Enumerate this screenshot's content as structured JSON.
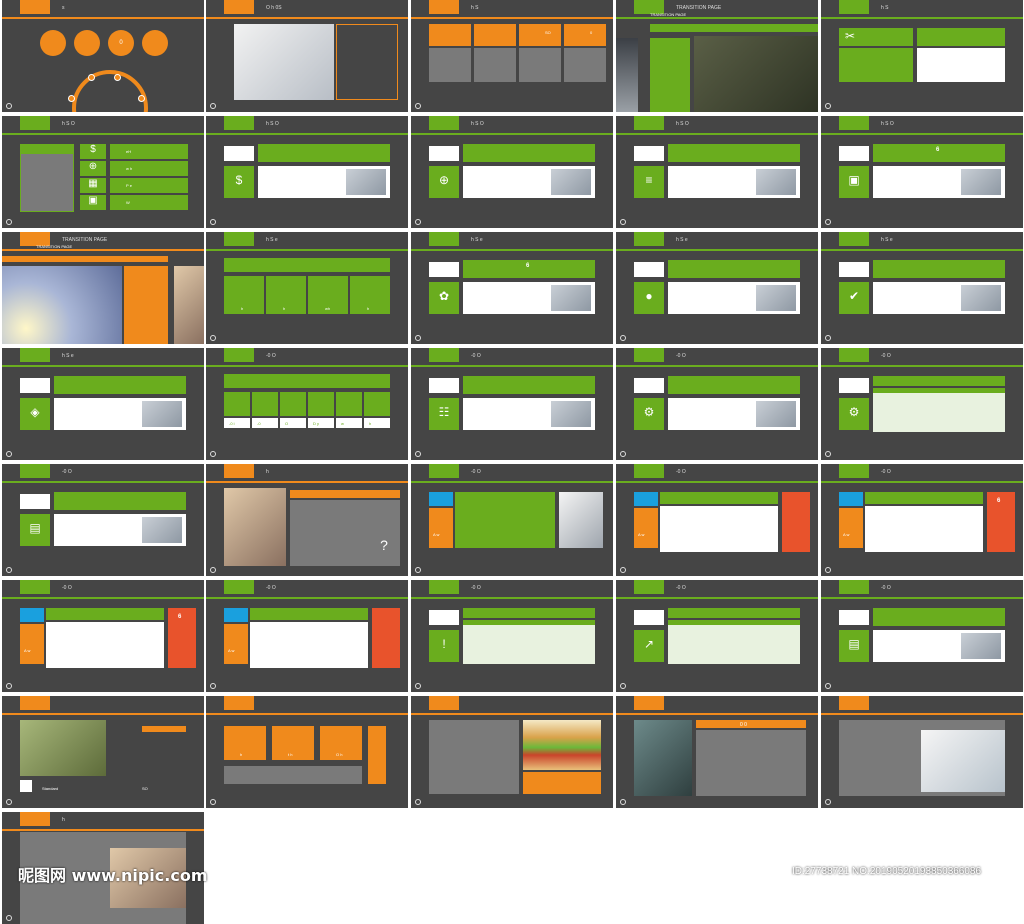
{
  "slides": [
    {
      "title": "s",
      "num": "",
      "type": "circles",
      "tab": "orange",
      "circle_label": "0"
    },
    {
      "title": "O h 0S",
      "num": "",
      "type": "photo-text",
      "tab": "orange"
    },
    {
      "title": "h S",
      "num": "",
      "type": "four-orange",
      "tab": "orange",
      "labels": [
        "",
        "",
        "SO",
        "0"
      ]
    },
    {
      "title": "TRANSITION PAGE",
      "num": "",
      "type": "transition-green",
      "tab": "green"
    },
    {
      "title": "h S",
      "num": "",
      "type": "tool-green",
      "tab": "green"
    },
    {
      "title": "h S O",
      "num": "",
      "type": "menu-list",
      "tab": "green",
      "items": [
        "eH",
        "w h",
        "P e",
        "W"
      ]
    },
    {
      "title": "h S O",
      "num": "",
      "type": "icon-card",
      "tab": "green",
      "icon": "$"
    },
    {
      "title": "h S O",
      "num": "",
      "type": "icon-card",
      "tab": "green",
      "icon": "⊕"
    },
    {
      "title": "h S O",
      "num": "",
      "type": "icon-card",
      "tab": "green",
      "icon": "≡"
    },
    {
      "title": "h S O",
      "num": "",
      "type": "icon-card",
      "tab": "green",
      "icon": "▣",
      "card_label": "6"
    },
    {
      "title": "TRANSITION PAGE",
      "num": "",
      "type": "transition-orange",
      "tab": "orange"
    },
    {
      "title": "h S e",
      "num": "",
      "type": "four-green",
      "tab": "green",
      "labels": [
        "h",
        "h",
        "wh",
        "h"
      ]
    },
    {
      "title": "h S e",
      "num": "",
      "type": "icon-card",
      "tab": "green",
      "icon": "✿",
      "card_label": "6"
    },
    {
      "title": "h S e",
      "num": "",
      "type": "icon-card",
      "tab": "green",
      "icon": "●"
    },
    {
      "title": "h S e",
      "num": "",
      "type": "icon-card",
      "tab": "green",
      "icon": "✔"
    },
    {
      "title": "h S e",
      "num": "",
      "type": "icon-card",
      "tab": "green",
      "icon": "◈"
    },
    {
      "title": "-0 O",
      "num": "",
      "type": "six-green",
      "tab": "green",
      "labels": [
        "-0 i",
        "-0",
        "O",
        "D y",
        "w",
        "h"
      ]
    },
    {
      "title": "-0 O",
      "num": "",
      "type": "icon-card",
      "tab": "green",
      "icon": "☷"
    },
    {
      "title": "-0 O",
      "num": "",
      "type": "icon-card",
      "tab": "green",
      "icon": "⚙"
    },
    {
      "title": "-0 O",
      "num": "",
      "type": "table-card",
      "tab": "green",
      "icon": "⚙"
    },
    {
      "title": "-0 O",
      "num": "",
      "type": "icon-card",
      "tab": "green",
      "icon": "▤"
    },
    {
      "title": "h",
      "num": "",
      "type": "orange-photo-q",
      "tab": "orange"
    },
    {
      "title": "-0 O",
      "num": "",
      "type": "blue-green",
      "tab": "green",
      "labels": [
        "A w"
      ]
    },
    {
      "title": "-0 O",
      "num": "",
      "type": "flow-red",
      "tab": "green",
      "labels": [
        "A w"
      ]
    },
    {
      "title": "-0 O",
      "num": "",
      "type": "gantt-red",
      "tab": "green",
      "labels": [
        "A w",
        "6"
      ]
    },
    {
      "title": "-0 O",
      "num": "",
      "type": "flow-red",
      "tab": "green",
      "labels": [
        "A w",
        "6"
      ]
    },
    {
      "title": "-0 O",
      "num": "",
      "type": "flow-red",
      "tab": "green",
      "labels": [
        "A w"
      ]
    },
    {
      "title": "-0 O",
      "num": "",
      "type": "table-card",
      "tab": "green",
      "icon": "!"
    },
    {
      "title": "-0 O",
      "num": "",
      "type": "table-card",
      "tab": "green",
      "icon": "↗"
    },
    {
      "title": "-0 O",
      "num": "",
      "type": "icon-card",
      "tab": "green",
      "icon": "▤"
    },
    {
      "title": "",
      "num": "",
      "type": "orange-photo-list",
      "tab": "orange",
      "labels": [
        "Standard",
        "SO"
      ]
    },
    {
      "title": "",
      "num": "",
      "type": "three-orange",
      "tab": "orange",
      "labels": [
        "h",
        "t h",
        "O h"
      ]
    },
    {
      "title": "",
      "num": "",
      "type": "food",
      "tab": "orange"
    },
    {
      "title": "",
      "num": "",
      "type": "statue",
      "tab": "orange",
      "labels": [
        "0 0"
      ]
    },
    {
      "title": "",
      "num": "",
      "type": "meeting",
      "tab": "orange"
    },
    {
      "title": "h",
      "num": "",
      "type": "last",
      "tab": "orange"
    }
  ],
  "watermark": {
    "left": "昵图网 www.nipic.com",
    "right": "ID:27738721 NO:20190520193850366086"
  },
  "colors": {
    "bg": "#454545",
    "orange": "#f08a1c",
    "green": "#6aad1e",
    "blue": "#1aa0de",
    "red": "#e8532c"
  }
}
